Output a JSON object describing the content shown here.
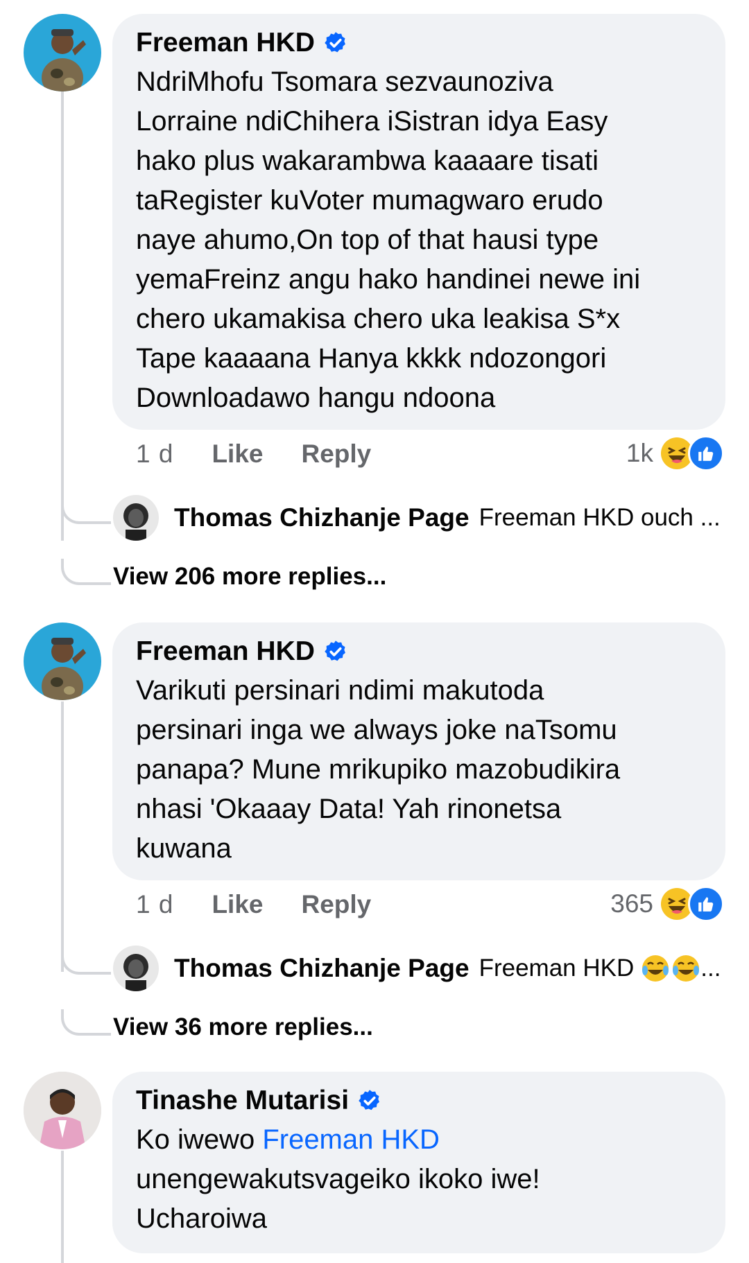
{
  "comments": [
    {
      "author": "Freeman HKD",
      "text": "NdriMhofu Tsomara sezvaunoziva\nLorraine  ndiChihera iSistran idya Easy\nhako plus wakarambwa kaaaare tisati\ntaRegister kuVoter mumagwaro erudo\nnaye ahumo,On top of that hausi type\nyemaFreinz angu hako handinei newe ini\nchero ukamakisa chero uka leakisa S*x\nTape kaaaana Hanya kkkk ndozongori\nDownloadawo hangu ndoona",
      "time": "1 d",
      "like_label": "Like",
      "reply_label": "Reply",
      "reaction_count": "1k",
      "reply_preview": {
        "author": "Thomas Chizhanje Page",
        "snippet": "Freeman HKD ouch ..."
      },
      "view_more": "View 206 more replies..."
    },
    {
      "author": "Freeman HKD",
      "text": "Varikuti persinari ndimi makutoda\npersinari inga we always  joke naTsomu\npanapa? Mune mrikupiko mazobudikira\nnhasi 'Okaaay Data! Yah rinonetsa\nkuwana",
      "time": "1 d",
      "like_label": "Like",
      "reply_label": "Reply",
      "reaction_count": "365",
      "reply_preview": {
        "author": "Thomas Chizhanje Page",
        "snippet": "Freeman HKD",
        "snippet_suffix": "..."
      },
      "view_more": "View 36 more replies..."
    },
    {
      "author": "Tinashe Mutarisi",
      "text_prefix": "Ko iwewo ",
      "mention": "Freeman HKD",
      "text_rest": "\nunengewakutsvageiko ikoko iwe!\nUcharoiwa"
    }
  ],
  "icons": {
    "verified": "verified-badge-icon",
    "haha": "haha-reaction-icon",
    "like": "like-reaction-icon",
    "tears": "tears-of-joy-emoji-icon"
  },
  "colors": {
    "bubble": "#f0f2f5",
    "link": "#0866ff",
    "verified": "#0866ff",
    "meta": "#65676b"
  }
}
